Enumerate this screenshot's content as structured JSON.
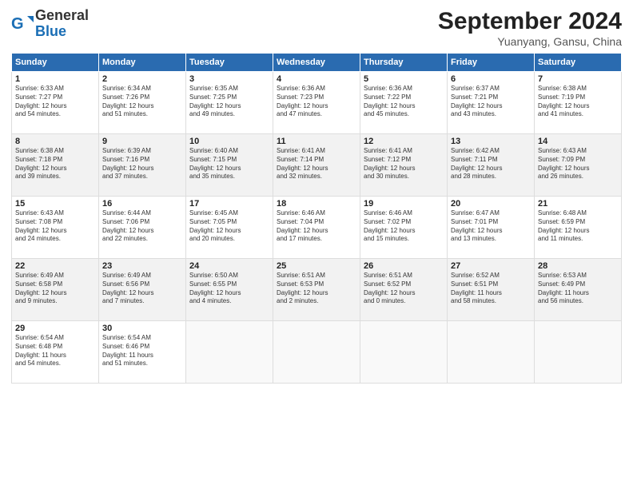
{
  "header": {
    "logo_general": "General",
    "logo_blue": "Blue",
    "month_title": "September 2024",
    "location": "Yuanyang, Gansu, China"
  },
  "weekdays": [
    "Sunday",
    "Monday",
    "Tuesday",
    "Wednesday",
    "Thursday",
    "Friday",
    "Saturday"
  ],
  "weeks": [
    [
      {
        "day": 1,
        "lines": [
          "Sunrise: 6:33 AM",
          "Sunset: 7:27 PM",
          "Daylight: 12 hours",
          "and 54 minutes."
        ]
      },
      {
        "day": 2,
        "lines": [
          "Sunrise: 6:34 AM",
          "Sunset: 7:26 PM",
          "Daylight: 12 hours",
          "and 51 minutes."
        ]
      },
      {
        "day": 3,
        "lines": [
          "Sunrise: 6:35 AM",
          "Sunset: 7:25 PM",
          "Daylight: 12 hours",
          "and 49 minutes."
        ]
      },
      {
        "day": 4,
        "lines": [
          "Sunrise: 6:36 AM",
          "Sunset: 7:23 PM",
          "Daylight: 12 hours",
          "and 47 minutes."
        ]
      },
      {
        "day": 5,
        "lines": [
          "Sunrise: 6:36 AM",
          "Sunset: 7:22 PM",
          "Daylight: 12 hours",
          "and 45 minutes."
        ]
      },
      {
        "day": 6,
        "lines": [
          "Sunrise: 6:37 AM",
          "Sunset: 7:21 PM",
          "Daylight: 12 hours",
          "and 43 minutes."
        ]
      },
      {
        "day": 7,
        "lines": [
          "Sunrise: 6:38 AM",
          "Sunset: 7:19 PM",
          "Daylight: 12 hours",
          "and 41 minutes."
        ]
      }
    ],
    [
      {
        "day": 8,
        "lines": [
          "Sunrise: 6:38 AM",
          "Sunset: 7:18 PM",
          "Daylight: 12 hours",
          "and 39 minutes."
        ]
      },
      {
        "day": 9,
        "lines": [
          "Sunrise: 6:39 AM",
          "Sunset: 7:16 PM",
          "Daylight: 12 hours",
          "and 37 minutes."
        ]
      },
      {
        "day": 10,
        "lines": [
          "Sunrise: 6:40 AM",
          "Sunset: 7:15 PM",
          "Daylight: 12 hours",
          "and 35 minutes."
        ]
      },
      {
        "day": 11,
        "lines": [
          "Sunrise: 6:41 AM",
          "Sunset: 7:14 PM",
          "Daylight: 12 hours",
          "and 32 minutes."
        ]
      },
      {
        "day": 12,
        "lines": [
          "Sunrise: 6:41 AM",
          "Sunset: 7:12 PM",
          "Daylight: 12 hours",
          "and 30 minutes."
        ]
      },
      {
        "day": 13,
        "lines": [
          "Sunrise: 6:42 AM",
          "Sunset: 7:11 PM",
          "Daylight: 12 hours",
          "and 28 minutes."
        ]
      },
      {
        "day": 14,
        "lines": [
          "Sunrise: 6:43 AM",
          "Sunset: 7:09 PM",
          "Daylight: 12 hours",
          "and 26 minutes."
        ]
      }
    ],
    [
      {
        "day": 15,
        "lines": [
          "Sunrise: 6:43 AM",
          "Sunset: 7:08 PM",
          "Daylight: 12 hours",
          "and 24 minutes."
        ]
      },
      {
        "day": 16,
        "lines": [
          "Sunrise: 6:44 AM",
          "Sunset: 7:06 PM",
          "Daylight: 12 hours",
          "and 22 minutes."
        ]
      },
      {
        "day": 17,
        "lines": [
          "Sunrise: 6:45 AM",
          "Sunset: 7:05 PM",
          "Daylight: 12 hours",
          "and 20 minutes."
        ]
      },
      {
        "day": 18,
        "lines": [
          "Sunrise: 6:46 AM",
          "Sunset: 7:04 PM",
          "Daylight: 12 hours",
          "and 17 minutes."
        ]
      },
      {
        "day": 19,
        "lines": [
          "Sunrise: 6:46 AM",
          "Sunset: 7:02 PM",
          "Daylight: 12 hours",
          "and 15 minutes."
        ]
      },
      {
        "day": 20,
        "lines": [
          "Sunrise: 6:47 AM",
          "Sunset: 7:01 PM",
          "Daylight: 12 hours",
          "and 13 minutes."
        ]
      },
      {
        "day": 21,
        "lines": [
          "Sunrise: 6:48 AM",
          "Sunset: 6:59 PM",
          "Daylight: 12 hours",
          "and 11 minutes."
        ]
      }
    ],
    [
      {
        "day": 22,
        "lines": [
          "Sunrise: 6:49 AM",
          "Sunset: 6:58 PM",
          "Daylight: 12 hours",
          "and 9 minutes."
        ]
      },
      {
        "day": 23,
        "lines": [
          "Sunrise: 6:49 AM",
          "Sunset: 6:56 PM",
          "Daylight: 12 hours",
          "and 7 minutes."
        ]
      },
      {
        "day": 24,
        "lines": [
          "Sunrise: 6:50 AM",
          "Sunset: 6:55 PM",
          "Daylight: 12 hours",
          "and 4 minutes."
        ]
      },
      {
        "day": 25,
        "lines": [
          "Sunrise: 6:51 AM",
          "Sunset: 6:53 PM",
          "Daylight: 12 hours",
          "and 2 minutes."
        ]
      },
      {
        "day": 26,
        "lines": [
          "Sunrise: 6:51 AM",
          "Sunset: 6:52 PM",
          "Daylight: 12 hours",
          "and 0 minutes."
        ]
      },
      {
        "day": 27,
        "lines": [
          "Sunrise: 6:52 AM",
          "Sunset: 6:51 PM",
          "Daylight: 11 hours",
          "and 58 minutes."
        ]
      },
      {
        "day": 28,
        "lines": [
          "Sunrise: 6:53 AM",
          "Sunset: 6:49 PM",
          "Daylight: 11 hours",
          "and 56 minutes."
        ]
      }
    ],
    [
      {
        "day": 29,
        "lines": [
          "Sunrise: 6:54 AM",
          "Sunset: 6:48 PM",
          "Daylight: 11 hours",
          "and 54 minutes."
        ]
      },
      {
        "day": 30,
        "lines": [
          "Sunrise: 6:54 AM",
          "Sunset: 6:46 PM",
          "Daylight: 11 hours",
          "and 51 minutes."
        ]
      },
      null,
      null,
      null,
      null,
      null
    ]
  ]
}
